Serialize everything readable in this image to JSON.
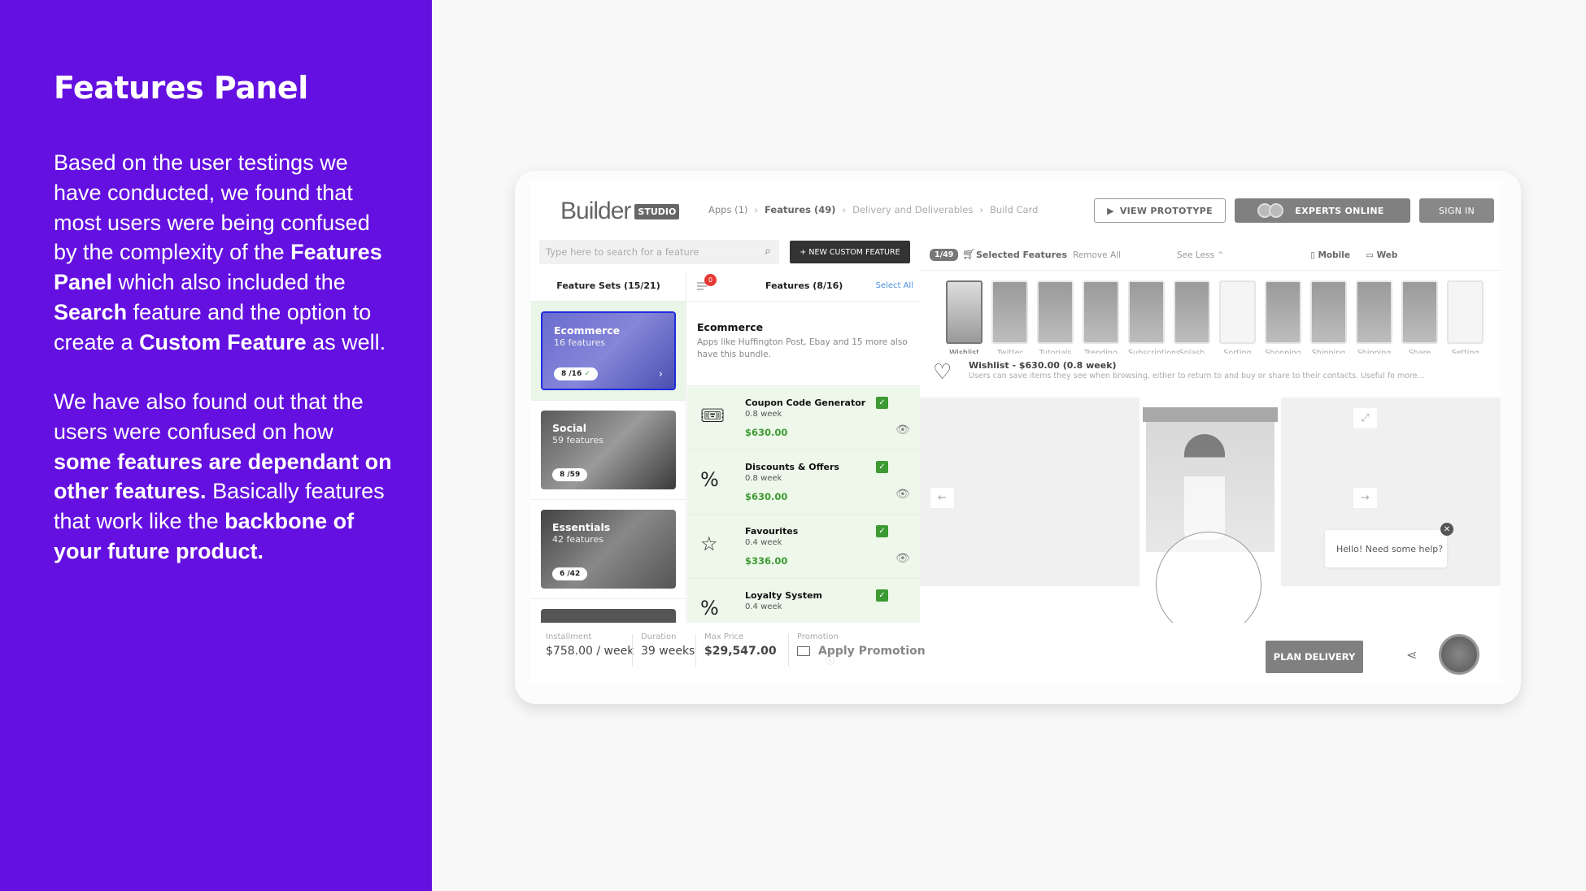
{
  "slide": {
    "title": "Features Panel",
    "paragraph1": [
      {
        "t": "Based on the user testings we have conducted, we found that most users were being confused by the complexity of the ",
        "b": false
      },
      {
        "t": "Features Panel",
        "b": true
      },
      {
        "t": " which also included the ",
        "b": false
      },
      {
        "t": "Search",
        "b": true
      },
      {
        "t": " feature and the option to create a ",
        "b": false
      },
      {
        "t": "Custom Feature",
        "b": true
      },
      {
        "t": " as well.",
        "b": false
      }
    ],
    "paragraph2": [
      {
        "t": "We have also found out that the users were confused  on how ",
        "b": false
      },
      {
        "t": "some features are dependant on other features.",
        "b": true
      },
      {
        "t": " Basically features that work like the ",
        "b": false
      },
      {
        "t": "backbone of your future product.",
        "b": true
      }
    ],
    "accent_color": "#6410e0"
  },
  "app": {
    "logo": {
      "word": "Builder",
      "tag": "STUDIO"
    },
    "breadcrumbs": [
      {
        "label": "Apps (1)",
        "state": "normal"
      },
      {
        "label": "Features (49)",
        "state": "active"
      },
      {
        "label": "Delivery and Deliverables",
        "state": "dim"
      },
      {
        "label": "Build Card",
        "state": "dim"
      }
    ],
    "header_buttons": {
      "view_prototype": "VIEW PROTOTYPE",
      "experts_online": "EXPERTS ONLINE",
      "sign_in": "SIGN IN"
    },
    "search": {
      "placeholder": "Type here to search for a feature",
      "value": ""
    },
    "new_custom_feature": "+  NEW CUSTOM FEATURE",
    "feature_sets": {
      "title": "Feature Sets (15/21)",
      "items": [
        {
          "name": "Ecommerce",
          "count": "16 features",
          "progress": "8 /16",
          "selected": true
        },
        {
          "name": "Social",
          "count": "59 features",
          "progress": "8 /59",
          "selected": false
        },
        {
          "name": "Essentials",
          "count": "42 features",
          "progress": "6 /42",
          "selected": false
        }
      ]
    },
    "features": {
      "title": "Features (8/16)",
      "filter_badge": "0",
      "select_all": "Select All",
      "bundle_title": "Ecommerce",
      "bundle_desc": "Apps like Huffington Post, Ebay and 15 more also have this bundle.",
      "items": [
        {
          "name": "Coupon Code Generator",
          "duration": "0.8 week",
          "price": "$630.00",
          "icon": "coupon-icon",
          "glyph": "🎟",
          "checked": true
        },
        {
          "name": "Discounts & Offers",
          "duration": "0.8 week",
          "price": "$630.00",
          "icon": "discount-icon",
          "glyph": "%",
          "checked": true
        },
        {
          "name": "Favourites",
          "duration": "0.4 week",
          "price": "$336.00",
          "icon": "star-icon",
          "glyph": "☆",
          "checked": true
        },
        {
          "name": "Loyalty System",
          "duration": "0.4 week",
          "price": "",
          "icon": "loyalty-icon",
          "glyph": "%",
          "checked": true
        }
      ]
    },
    "selected": {
      "count": "1/49",
      "title": "Selected Features",
      "remove_all": "Remove All",
      "see_less": "See Less ⌃",
      "mobile": "Mobile",
      "web": "Web",
      "thumbnails": [
        {
          "label": "Wishlist",
          "selected": true
        },
        {
          "label": "Twitter Login"
        },
        {
          "label": "Tutorials"
        },
        {
          "label": "Trending"
        },
        {
          "label": "Subscriptions"
        },
        {
          "label": "Splash Screen"
        },
        {
          "label": "Sorting"
        },
        {
          "label": "Shopping Cart"
        },
        {
          "label": "Shipping Charge"
        },
        {
          "label": "Shipping Address"
        },
        {
          "label": "Share"
        },
        {
          "label": "Setting"
        }
      ]
    },
    "detail": {
      "title": "Wishlist - $630.00 (0.8 week)",
      "desc": "Users can save items they see when browsing, either to return to and buy or share to their contacts. Useful fo more..."
    },
    "help_chat": "Hello! Need some help?",
    "footer": {
      "installment_label": "Installment",
      "installment": "$758.00 / week",
      "duration_label": "Duration",
      "duration": "39 weeks",
      "max_price_label": "Max Price",
      "max_price": "$29,547.00",
      "promotion_label": "Promotion",
      "promotion": "Apply Promotion",
      "plan_delivery": "PLAN DELIVERY"
    }
  }
}
